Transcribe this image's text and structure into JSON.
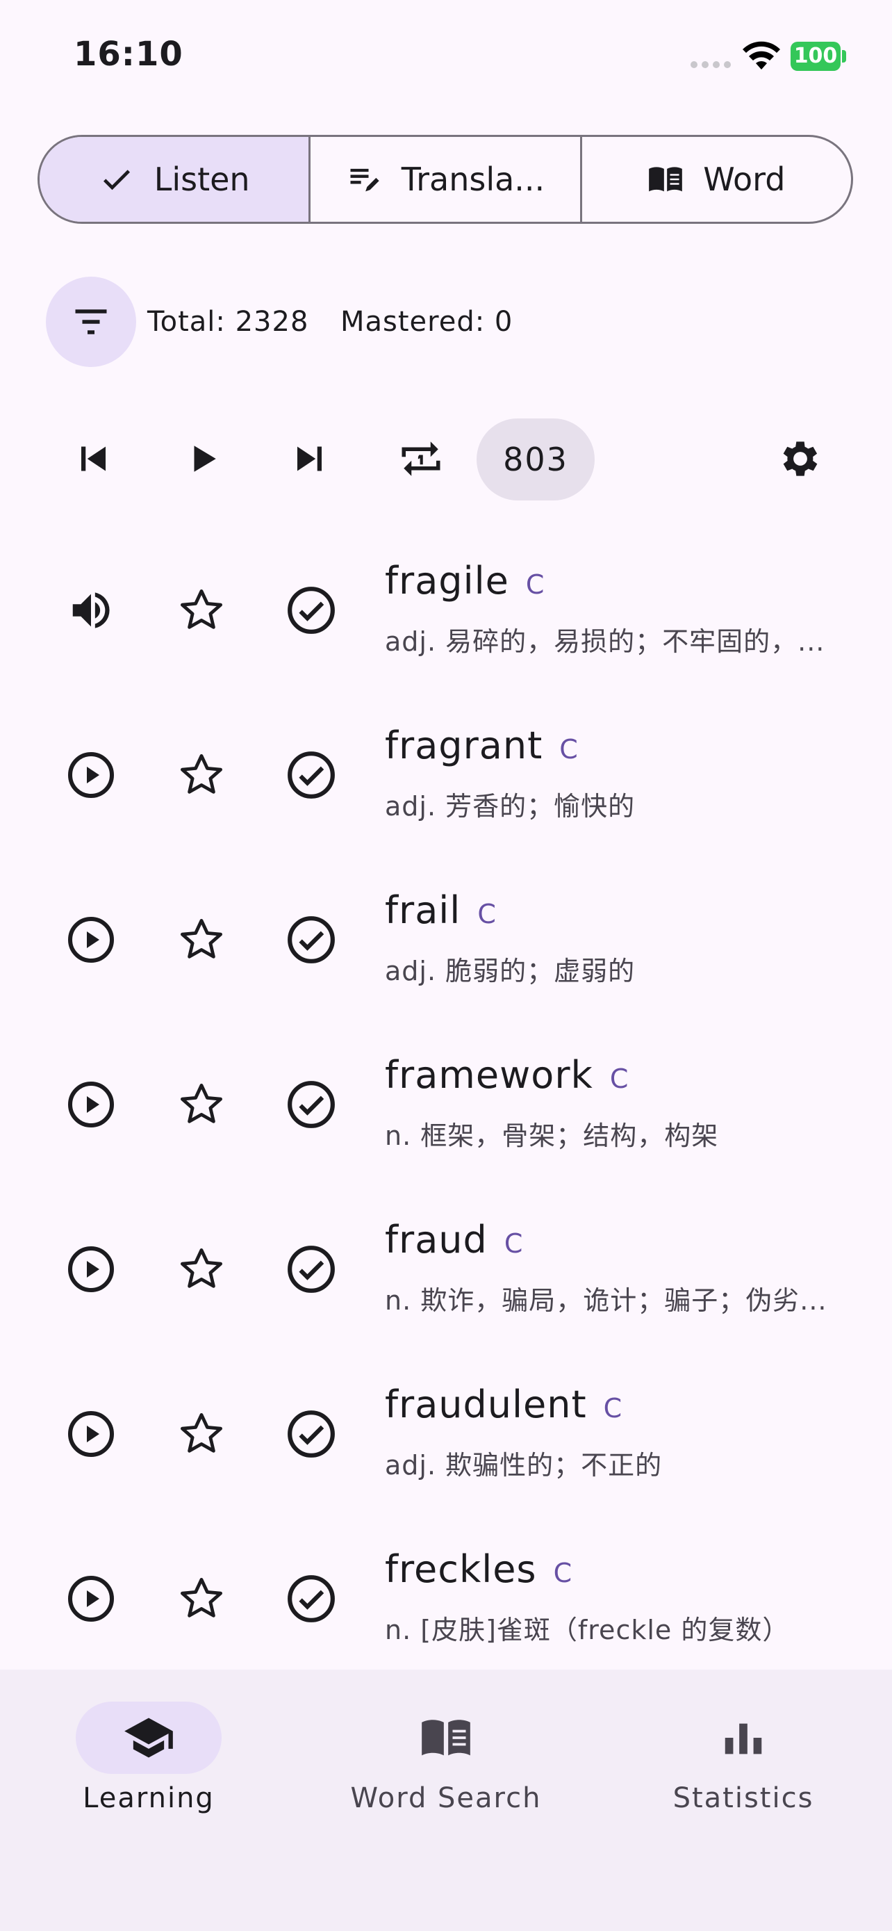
{
  "status_bar": {
    "time": "16:10",
    "battery": "100"
  },
  "mode_tabs": [
    {
      "label": "Listen",
      "icon": "check-icon",
      "selected": true
    },
    {
      "label": "Transla...",
      "icon": "edit-note-icon",
      "selected": false
    },
    {
      "label": "Word",
      "icon": "book-icon",
      "selected": false
    }
  ],
  "stats": {
    "total": "Total: 2328",
    "mastered": "Mastered: 0"
  },
  "player": {
    "count": "803"
  },
  "words": [
    {
      "word": "fragile",
      "level": "C",
      "meaning": "adj. 易碎的，易损的；不牢固的，...",
      "audio_icon": "volume-up-icon"
    },
    {
      "word": "fragrant",
      "level": "C",
      "meaning": "adj. 芳香的；愉快的",
      "audio_icon": "play-circle-icon"
    },
    {
      "word": "frail",
      "level": "C",
      "meaning": "adj. 脆弱的；虚弱的",
      "audio_icon": "play-circle-icon"
    },
    {
      "word": "framework",
      "level": "C",
      "meaning": "n. 框架，骨架；结构，构架",
      "audio_icon": "play-circle-icon"
    },
    {
      "word": "fraud",
      "level": "C",
      "meaning": "n. 欺诈，骗局，诡计；骗子；伪劣...",
      "audio_icon": "play-circle-icon"
    },
    {
      "word": "fraudulent",
      "level": "C",
      "meaning": "adj. 欺骗性的；不正的",
      "audio_icon": "play-circle-icon"
    },
    {
      "word": "freckles",
      "level": "C",
      "meaning": "n. [皮肤]雀斑（freckle 的复数）",
      "audio_icon": "play-circle-icon"
    }
  ],
  "bottom_nav": [
    {
      "label": "Learning",
      "icon": "school-icon",
      "active": true
    },
    {
      "label": "Word Search",
      "icon": "book-icon",
      "active": false
    },
    {
      "label": "Statistics",
      "icon": "bar-chart-icon",
      "active": false
    }
  ],
  "colors": {
    "accent_container": "#e8def8",
    "background": "#fdf7fe",
    "level_color": "#6750a4",
    "battery": "#34c759"
  }
}
